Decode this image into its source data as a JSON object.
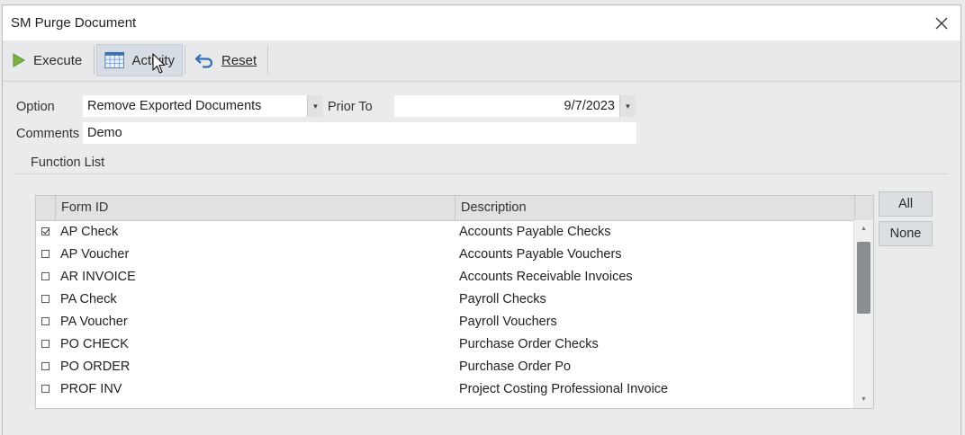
{
  "window": {
    "title": "SM Purge Document"
  },
  "toolbar": {
    "execute_label": "Execute",
    "activity_label": "Activity",
    "reset_label": "Reset"
  },
  "form": {
    "option_label": "Option",
    "option_value": "Remove Exported Documents",
    "prior_to_label": "Prior To",
    "prior_to_value": "9/7/2023",
    "comments_label": "Comments",
    "comments_value": "Demo",
    "function_list_label": "Function List"
  },
  "grid": {
    "columns": [
      "Form ID",
      "Description"
    ],
    "rows": [
      {
        "checked": true,
        "form_id": "AP Check",
        "description": "Accounts Payable Checks"
      },
      {
        "checked": false,
        "form_id": "AP Voucher",
        "description": "Accounts Payable Vouchers"
      },
      {
        "checked": false,
        "form_id": "AR INVOICE",
        "description": "Accounts Receivable Invoices"
      },
      {
        "checked": false,
        "form_id": "PA Check",
        "description": "Payroll Checks"
      },
      {
        "checked": false,
        "form_id": "PA Voucher",
        "description": "Payroll Vouchers"
      },
      {
        "checked": false,
        "form_id": "PO CHECK",
        "description": "Purchase Order Checks"
      },
      {
        "checked": false,
        "form_id": "PO ORDER",
        "description": "Purchase Order Po"
      },
      {
        "checked": false,
        "form_id": "PROF INV",
        "description": "Project Costing Professional Invoice"
      }
    ]
  },
  "buttons": {
    "all_label": "All",
    "none_label": "None"
  },
  "colors": {
    "execute_accent": "#7cb342",
    "reset_accent": "#2f6fb6"
  },
  "icons": {
    "close": "close-icon",
    "execute": "play-icon",
    "activity": "calendar-grid-icon",
    "reset": "undo-arrow-icon",
    "dropdown": "chevron-down-icon"
  }
}
